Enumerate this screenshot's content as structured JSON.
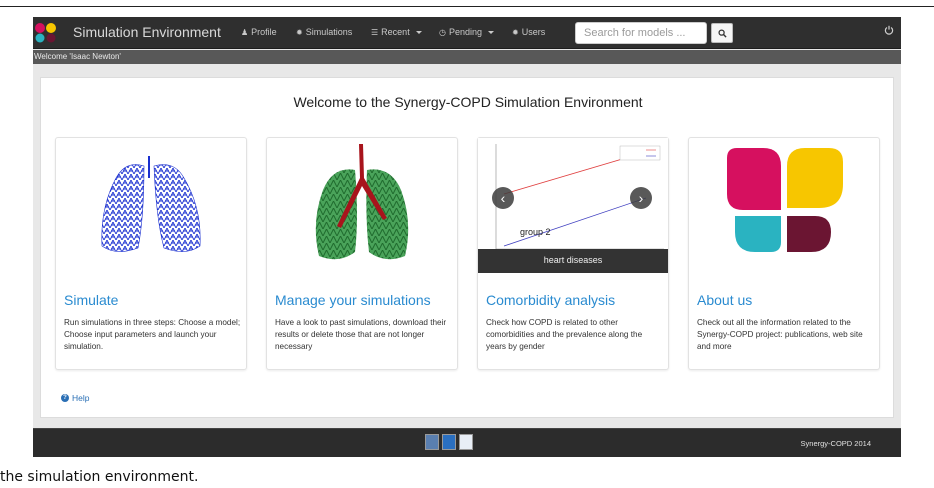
{
  "navbar": {
    "brand": "Simulation Environment",
    "items": [
      {
        "label": "Profile",
        "icon": "user-icon"
      },
      {
        "label": "Simulations",
        "icon": "gear-icon"
      },
      {
        "label": "Recent",
        "icon": "list-icon",
        "dropdown": true
      },
      {
        "label": "Pending",
        "icon": "clock-icon",
        "dropdown": true
      },
      {
        "label": "Users",
        "icon": "gear-icon"
      }
    ],
    "search_placeholder": "Search for models ...",
    "search_value": ""
  },
  "welcome_strip": "Welcome 'Isaac Newton'",
  "main": {
    "title": "Welcome to the Synergy-COPD Simulation Environment",
    "cards": [
      {
        "title": "Simulate",
        "text": "Run simulations in three steps: Choose a model; Choose input parameters and launch your simulation."
      },
      {
        "title": "Manage your simulations",
        "text": "Have a look to past simulations, download their results or delete those that are not longer necessary"
      },
      {
        "title": "Comorbidity analysis",
        "text": "Check how COPD is related to other comorbidities and the prevalence along the years by gender",
        "carousel_caption": "heart diseases",
        "group_label": "group 2",
        "legend": [
          "COPD",
          "no COPD"
        ]
      },
      {
        "title": "About us",
        "text": "Check out all the information related to the Synergy-COPD project: publications, web site and more"
      }
    ],
    "help": "Help"
  },
  "footer": {
    "text": "Synergy-COPD 2014"
  },
  "caption": "the simulation environment.",
  "colors": {
    "navbar": "#2f2f2f",
    "link": "#2a8bd0",
    "logo_pink": "#d6105f",
    "logo_yellow": "#f7c600",
    "logo_teal": "#2ab3c1",
    "logo_maroon": "#6b1532"
  }
}
